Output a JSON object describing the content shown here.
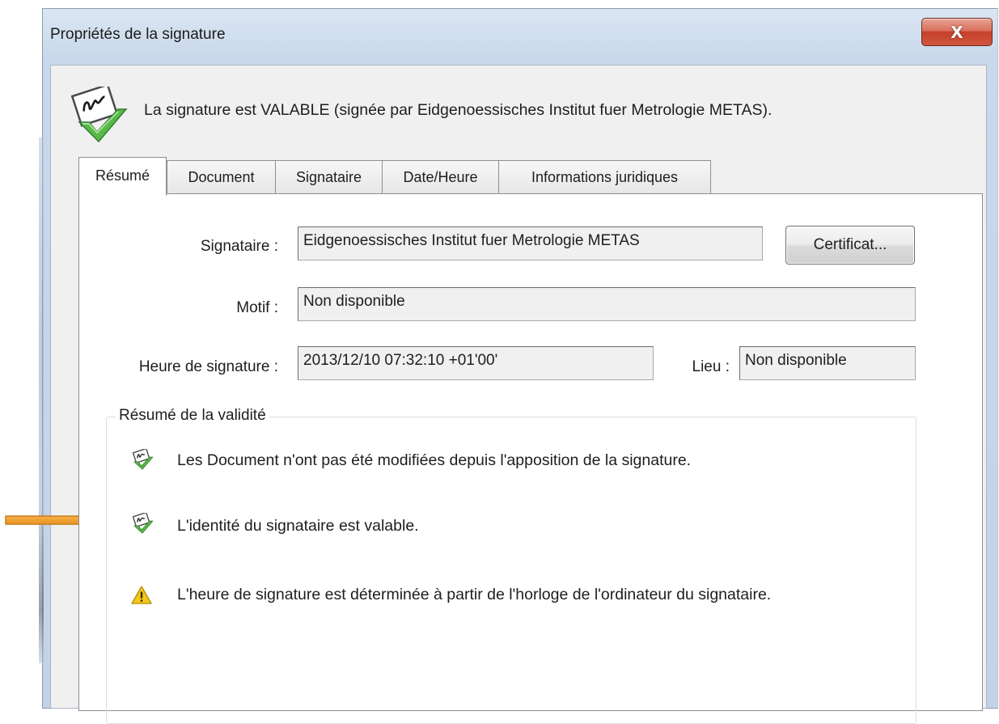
{
  "window": {
    "title": "Propriétés de la signature",
    "close_label": "X"
  },
  "header": {
    "status_text": "La signature est VALABLE (signée par Eidgenoessisches Institut fuer Metrologie METAS)."
  },
  "tabs": [
    {
      "label": "Résumé",
      "active": true
    },
    {
      "label": "Document",
      "active": false
    },
    {
      "label": "Signataire",
      "active": false
    },
    {
      "label": "Date/Heure",
      "active": false
    },
    {
      "label": "Informations juridiques",
      "active": false
    }
  ],
  "form": {
    "signer_label": "Signataire :",
    "signer_value": "Eidgenoessisches Institut fuer Metrologie METAS",
    "certificate_button": "Certificat...",
    "reason_label": "Motif :",
    "reason_value": "Non disponible",
    "time_label": "Heure de signature :",
    "time_value": "2013/12/10 07:32:10 +01'00'",
    "location_label": "Lieu :",
    "location_value": "Non disponible"
  },
  "validity": {
    "title": "Résumé de la validité",
    "items": [
      {
        "icon": "signature-valid-icon",
        "text": "Les Document n'ont pas été modifiées depuis l'apposition de la signature."
      },
      {
        "icon": "signature-valid-icon",
        "text": "L'identité du signataire est valable."
      },
      {
        "icon": "warning-icon",
        "text": "L'heure de signature est déterminée à partir de l'horloge de l'ordinateur du signataire."
      }
    ]
  },
  "annotation": {
    "icon": "orange-arrow-icon",
    "color": "#f0a030"
  }
}
